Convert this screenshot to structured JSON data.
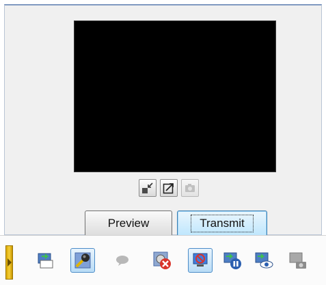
{
  "controls": {
    "preview_label": "Preview",
    "transmit_label": "Transmit"
  },
  "icons": {
    "video_buttons": [
      "shrink-video-icon",
      "pop-out-video-icon",
      "snapshot-icon"
    ],
    "toolbar": [
      "send-file-icon",
      "microphone-settings-icon",
      "chat-bubble-icon",
      "stop-call-icon",
      "stop-presentation-icon",
      "pause-share-icon",
      "view-share-icon",
      "camera-share-icon"
    ]
  },
  "colors": {
    "accent": "#3c7fb1",
    "stop_red": "#d9342b",
    "icon_green": "#2e9e3c",
    "grip_gold": "#e6b81a"
  }
}
